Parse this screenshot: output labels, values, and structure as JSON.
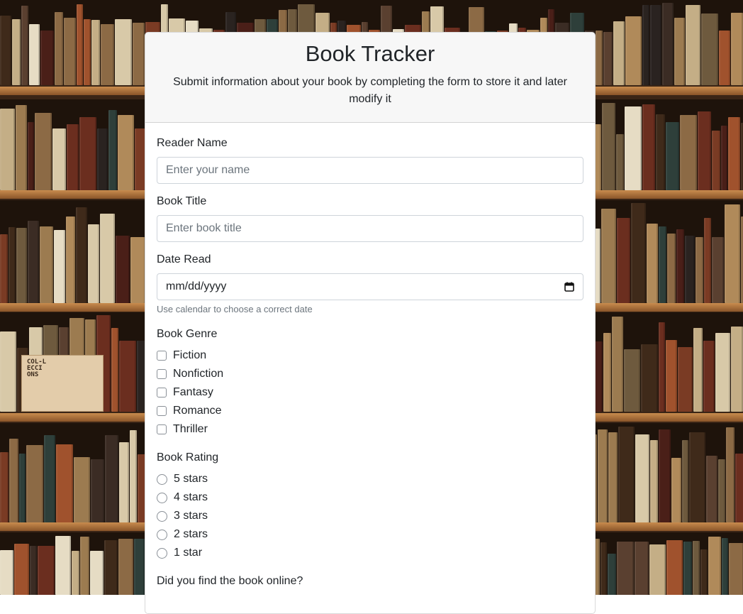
{
  "header": {
    "title": "Book Tracker",
    "subtitle": "Submit information about your book by completing the form to store it and later modify it"
  },
  "form": {
    "reader_name": {
      "label": "Reader Name",
      "placeholder": "Enter your name",
      "value": ""
    },
    "book_title": {
      "label": "Book Title",
      "placeholder": "Enter book title",
      "value": ""
    },
    "date_read": {
      "label": "Date Read",
      "placeholder": "mm/dd/yyyy",
      "help": "Use calendar to choose a correct date",
      "icon": "calendar-icon"
    },
    "genre": {
      "label": "Book Genre",
      "options": [
        "Fiction",
        "Nonfiction",
        "Fantasy",
        "Romance",
        "Thriller"
      ]
    },
    "rating": {
      "label": "Book Rating",
      "options": [
        "5 stars",
        "4 stars",
        "3 stars",
        "2 stars",
        "1 star"
      ]
    },
    "online": {
      "label": "Did you find the book online?"
    }
  },
  "background": {
    "box_label": "COL-L\nECCI\nONS"
  },
  "colors": {
    "card_header_bg": "#f7f7f7",
    "input_border": "#ced4da",
    "muted_text": "#6c757d",
    "wood": "#a76a37"
  }
}
